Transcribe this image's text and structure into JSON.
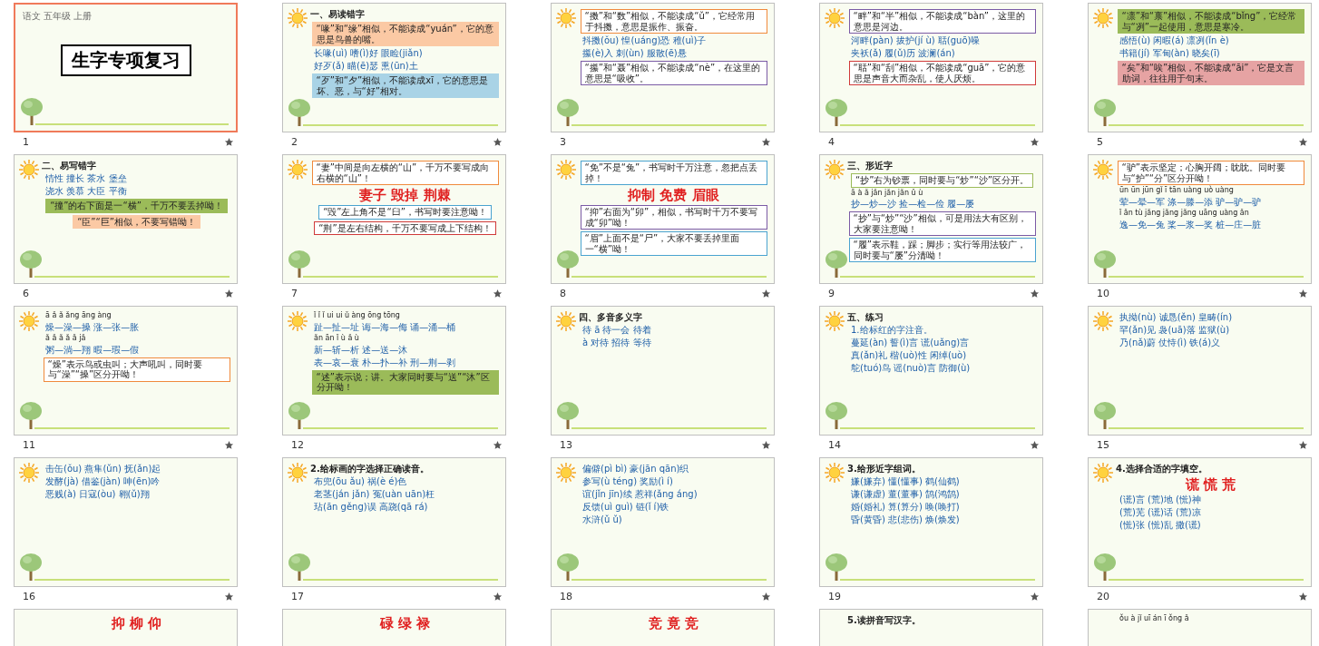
{
  "slides": [
    {
      "number": "1",
      "kind": "cover",
      "selected": true,
      "items": [
        {
          "kind": "meta",
          "text": "语文 五年级 上册"
        },
        {
          "kind": "title",
          "text": "生字专项复习"
        }
      ]
    },
    {
      "number": "2",
      "kind": "content",
      "selected": false,
      "items": [
        {
          "kind": "heading",
          "text": "一、易读错字"
        },
        {
          "kind": "note",
          "color": "#fbc9a4",
          "text": "“喙”和“缘”相似，不能读成“yuán”，它的意思是鸟兽的嘴。"
        },
        {
          "kind": "line",
          "text": "长喙(uì)  嗜(ì)好  眼睑(jiǎn)"
        },
        {
          "kind": "line",
          "text": "好歹(ǎ)  瞄(ē)瑟  熏(ūn)土"
        },
        {
          "kind": "note",
          "color": "#a9d3e6",
          "text": "“歹”和“夕”相似，不能读成xī，它的意思是坏、恶，与“好”相对。"
        }
      ]
    },
    {
      "number": "3",
      "kind": "content",
      "selected": false,
      "items": [
        {
          "kind": "callout",
          "color": "#f08a3c",
          "text": "“擞”和“数”相似，不能读成“ǔ”，它经常用于抖擞，意思是振作、振奋。"
        },
        {
          "kind": "line",
          "text": "抖擞(ǒu)  惶(uáng)恐  稚(uì)子"
        },
        {
          "kind": "line",
          "text": "攥(è)入  刺(ùn)  服散(ē)悬"
        },
        {
          "kind": "callout",
          "color": "#7b5ba6",
          "text": "“攥”和“聂”相似，不能读成“nè”，在这里的意思是“吸收”。"
        }
      ]
    },
    {
      "number": "4",
      "kind": "content",
      "selected": false,
      "items": [
        {
          "kind": "callout",
          "color": "#7b5ba6",
          "text": "“畔”和“半”相似，不能读成“bàn”，这里的意思是河边。"
        },
        {
          "kind": "line",
          "text": "河畔(pàn)  拔护(jí ù)  聒(guō)噪"
        },
        {
          "kind": "line",
          "text": "夹袄(ǎ)  履(ǔ)历  波澜(án)"
        },
        {
          "kind": "callout",
          "color": "#d03a3a",
          "text": "“聒”和“刮”相似，不能读成“guā”，它的意思是声音大而杂乱，使人厌烦。"
        }
      ]
    },
    {
      "number": "5",
      "kind": "content",
      "selected": false,
      "items": [
        {
          "kind": "note",
          "color": "#9bbb59",
          "text": "“凛”和“禀”相似，不能读成“bǐng”，它经常与“冽”一起使用，意思是寒冷。"
        },
        {
          "kind": "line",
          "text": "感悟(ù)  闲暇(á)  凛冽(ǐn è)"
        },
        {
          "kind": "line",
          "text": "书籍(jí)  军甸(àn)  晓矣(ī)"
        },
        {
          "kind": "note",
          "color": "#e6a3a3",
          "text": "“矣”和“唉”相似，不能读成“āi”，它是文言助词，往往用于句末。"
        }
      ]
    },
    {
      "number": "6",
      "kind": "content",
      "selected": false,
      "items": [
        {
          "kind": "heading",
          "text": "二、易写错字"
        },
        {
          "kind": "line",
          "text": "情性  撞长  茶水  堡垒"
        },
        {
          "kind": "line",
          "text": "浇水  羡慕  大臣  平衡"
        },
        {
          "kind": "note",
          "color": "#9bbb59",
          "text": "“撞”的右下面是一“横”，千万不要丢掉呦！"
        },
        {
          "kind": "note",
          "color": "#fbc9a4",
          "text": "“臣”“巨”相似，不要写错呦！"
        }
      ]
    },
    {
      "number": "7",
      "kind": "content",
      "selected": false,
      "items": [
        {
          "kind": "callout",
          "color": "#f08a3c",
          "text": "“妻”中间是向左横的“山”，千万不要写成向右横的“山”！"
        },
        {
          "kind": "big",
          "text": "妻子  毁掉  荆棘"
        },
        {
          "kind": "callout",
          "color": "#4aa3d0",
          "text": "“毁”左上角不是“臼”，书写时要注意呦！"
        },
        {
          "kind": "callout",
          "color": "#d03a3a",
          "text": "“荆”是左右结构，千万不要写成上下结构！"
        }
      ]
    },
    {
      "number": "8",
      "kind": "content",
      "selected": false,
      "items": [
        {
          "kind": "callout",
          "color": "#4aa3d0",
          "text": "“免”不是“兔”，书写时千万注意，忽把点丢掉！"
        },
        {
          "kind": "big",
          "text": "抑制  免费  眉眼"
        },
        {
          "kind": "callout",
          "color": "#7b5ba6",
          "text": "“抑”右面为“卯”，相似，书写时千万不要写成“卯”呦！"
        },
        {
          "kind": "callout",
          "color": "#4aa3d0",
          "text": "“眉”上面不是“尸”，大家不要丢掉里面一“横”呦！"
        }
      ]
    },
    {
      "number": "9",
      "kind": "content",
      "selected": false,
      "items": [
        {
          "kind": "heading",
          "text": "三、形近字"
        },
        {
          "kind": "callout",
          "color": "#9bbb59",
          "text": "“抄”右为钞票，同时要与“炒”“沙”区分开。"
        },
        {
          "kind": "pinyin",
          "text": "ā à ǎ   jǎn jǎn jǎn   ǔ ù"
        },
        {
          "kind": "line",
          "text": "抄—炒—沙  捡—检—俭  履—屡"
        },
        {
          "kind": "callout",
          "color": "#7b5ba6",
          "text": "“抄”与“炒”“沙”相似，可是用法大有区别，大家要注意呦！"
        },
        {
          "kind": "callout",
          "color": "#4aa3d0",
          "text": "“履”表示鞋，踩；脚步；实行等用法较广，同时要与“屡”分清呦！"
        }
      ]
    },
    {
      "number": "10",
      "kind": "content",
      "selected": false,
      "items": [
        {
          "kind": "callout",
          "color": "#f08a3c",
          "text": "“驴”表示坚定；心胸开阔；眈眈。同时要与“护”“分”区分开呦！"
        },
        {
          "kind": "pinyin",
          "text": "ūn ūn jūn  gǐ ī tān  uàng uò uàng"
        },
        {
          "kind": "line",
          "text": "荤—晕—军  涤—滕—添  驴—驴—驴"
        },
        {
          "kind": "pinyin",
          "text": "ǐ ǎn tù  jǎng jǎng jǎng  uāng uàng ǎn"
        },
        {
          "kind": "line",
          "text": "逸—免—兔  桨—浆—奖  桩—庄—脏"
        }
      ]
    },
    {
      "number": "11",
      "kind": "content",
      "selected": false,
      "items": [
        {
          "kind": "pinyin",
          "text": "ā ǎ ǎ      ǎng āng àng"
        },
        {
          "kind": "line",
          "text": "燥—澡—操   涨—张—胀"
        },
        {
          "kind": "pinyin",
          "text": "ǎ ǎ ǎ      ǎ ǎ jǎ"
        },
        {
          "kind": "line",
          "text": "粥—淌—翔   暇—瑕—假"
        },
        {
          "kind": "callout",
          "color": "#f08a3c",
          "text": "“燥”表示鸟或虫叫；大声吼叫，同时要与“澡”“操”区分开呦！"
        }
      ]
    },
    {
      "number": "12",
      "kind": "content",
      "selected": false,
      "items": [
        {
          "kind": "pinyin",
          "text": "ǐ ǐ ǐ  ui ui ǔ  àng ōng tōng"
        },
        {
          "kind": "line",
          "text": "趾—扯—址 诲—海—侮 诵—涌—桶"
        },
        {
          "kind": "pinyin",
          "text": "ǎn ān ǐ  ù ǎ ù"
        },
        {
          "kind": "line",
          "text": "新—斩—析 述—送—沐"
        },
        {
          "kind": "line",
          "text": "表—哀—衰 朴—扑—补 刑—荆—剥"
        },
        {
          "kind": "note",
          "color": "#9bbb59",
          "text": "“述”表示说；讲。大家同时要与“送”“沐”区分开呦！"
        }
      ]
    },
    {
      "number": "13",
      "kind": "content",
      "selected": false,
      "items": [
        {
          "kind": "heading",
          "text": "四、多音多义字"
        },
        {
          "kind": "line",
          "text": "待  ā  待一会  待着"
        },
        {
          "kind": "line",
          "text": "à  对待  招待  等待"
        }
      ]
    },
    {
      "number": "14",
      "kind": "content",
      "selected": false,
      "items": [
        {
          "kind": "heading",
          "text": "五、练习"
        },
        {
          "kind": "line",
          "text": "1.给标红的字注音。"
        },
        {
          "kind": "line",
          "text": "蔓延(àn)  誓(ì)言  谎(uǎng)言"
        },
        {
          "kind": "line",
          "text": "真(ǎn)礼  楷(uò)性  闲绰(uò)"
        },
        {
          "kind": "line",
          "text": "鸵(tuó)鸟  谣(nuò)言  防御(ù)"
        }
      ]
    },
    {
      "number": "15",
      "kind": "content",
      "selected": false,
      "items": [
        {
          "kind": "line",
          "text": "执拗(nù)  诚恳(ěn)  皇畴(ín)"
        },
        {
          "kind": "line",
          "text": "罕(ǎn)见  袅(uā)落  监狱(ù)"
        },
        {
          "kind": "line",
          "text": "乃(nǎ)蔚  仗恃(ì)  铁(á)义"
        }
      ]
    },
    {
      "number": "16",
      "kind": "content",
      "selected": false,
      "items": [
        {
          "kind": "line",
          "text": "击缶(ǒu)  燕隼(ǔn)  抚(ǎn)起"
        },
        {
          "kind": "line",
          "text": "发酵(jà)  借鉴(jàn)  呻(ēn)吟"
        },
        {
          "kind": "line",
          "text": "恶贱(à)  日寇(òu)  翱(ǔ)翔"
        }
      ]
    },
    {
      "number": "17",
      "kind": "content",
      "selected": false,
      "items": [
        {
          "kind": "heading",
          "text": "2.给标画的字选择正确读音。"
        },
        {
          "kind": "line",
          "text": "布兜(ōu ǎu)  祸(è é)色"
        },
        {
          "kind": "line",
          "text": "老茎(ján jǎn)  冤(uàn uān)枉"
        },
        {
          "kind": "line",
          "text": "玷(ān gěng)误  高跷(qā rá)"
        }
      ]
    },
    {
      "number": "18",
      "kind": "content",
      "selected": false,
      "items": [
        {
          "kind": "line",
          "text": "偏僻(pì bì)  豪(jān qān)织"
        },
        {
          "kind": "line",
          "text": "参写(ù téng)  奖励(ì í)"
        },
        {
          "kind": "line",
          "text": "谊(jǐn jīn)续  惹祥(ǎng áng)"
        },
        {
          "kind": "line",
          "text": "反馈(uì guì)  链(ǐ í)铁"
        },
        {
          "kind": "line",
          "text": "水浒(ǔ ǔ)"
        }
      ]
    },
    {
      "number": "19",
      "kind": "content",
      "selected": false,
      "items": [
        {
          "kind": "heading",
          "text": "3.给形近字组词。"
        },
        {
          "kind": "line",
          "text": "嫌(嫌弃) 懂(懂事) 鹤(仙鹤)"
        },
        {
          "kind": "line",
          "text": "谦(谦虚) 董(董事) 鹄(鸿鹄)"
        },
        {
          "kind": "line",
          "text": "婚(婚礼) 算(算分) 唤(唤打)"
        },
        {
          "kind": "line",
          "text": "昏(黄昏) 悲(悲伤) 焕(焕发)"
        }
      ]
    },
    {
      "number": "20",
      "kind": "content",
      "selected": false,
      "items": [
        {
          "kind": "heading",
          "text": "4.选择合适的字填空。"
        },
        {
          "kind": "big",
          "text": "谎  慌  荒"
        },
        {
          "kind": "line",
          "text": "(谎)言  (荒)地  (慌)神"
        },
        {
          "kind": "line",
          "text": "(荒)芜  (谎)话  (荒)凉"
        },
        {
          "kind": "line",
          "text": "(慌)张  (慌)乱  撒(谎)"
        }
      ]
    },
    {
      "kind": "partial",
      "selected": false,
      "items": [
        {
          "kind": "big",
          "text": "抑  柳  仰"
        }
      ]
    },
    {
      "kind": "partial",
      "selected": false,
      "items": [
        {
          "kind": "big",
          "text": "碌  绿  禄"
        }
      ]
    },
    {
      "kind": "partial",
      "selected": false,
      "items": [
        {
          "kind": "big",
          "text": "竞  竟  竞"
        }
      ]
    },
    {
      "kind": "partial",
      "selected": false,
      "items": [
        {
          "kind": "heading",
          "text": "5.读拼音写汉字。"
        }
      ]
    },
    {
      "kind": "partial",
      "selected": false,
      "items": [
        {
          "kind": "pinyin",
          "text": "ǒu à   jǐ uī   án ī   ǒng ǎ"
        }
      ]
    }
  ]
}
